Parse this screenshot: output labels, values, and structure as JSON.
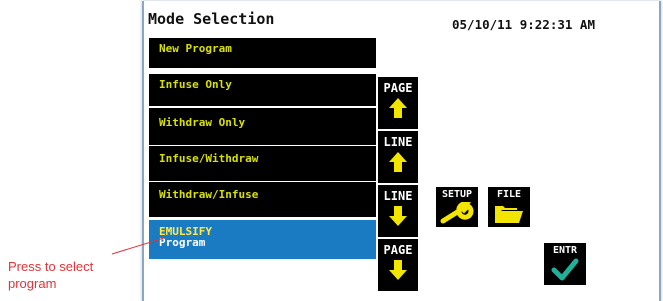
{
  "header": {
    "title": "Mode Selection",
    "datetime": "05/10/11 9:22:31 AM"
  },
  "menu": {
    "items": [
      {
        "label": "New Program"
      },
      {
        "label": "Infuse Only"
      },
      {
        "label": "Withdraw Only"
      },
      {
        "label": "Infuse/Withdraw"
      },
      {
        "label": "Withdraw/Infuse"
      }
    ],
    "selected": {
      "line1": "EMULSIFY",
      "line2": "Program"
    }
  },
  "buttons": {
    "page_up": "PAGE",
    "line_up": "LINE",
    "line_down": "LINE",
    "page_down": "PAGE",
    "setup": "SETUP",
    "file": "FILE",
    "enter": "ENTR"
  },
  "callout": {
    "text": "Press to  select program"
  },
  "colors": {
    "menu_bg": "#000000",
    "menu_text": "#d8e000",
    "selected_bg": "#1b7bc2",
    "arrow": "#f2e600",
    "check": "#1fb09a",
    "callout": "#e0343a",
    "panel_border": "#8fa7be"
  },
  "icons": {
    "page_up": "arrow-up-icon",
    "line_up": "arrow-up-icon",
    "line_down": "arrow-down-icon",
    "page_down": "arrow-down-icon",
    "setup": "wrench-icon",
    "file": "folder-icon",
    "enter": "checkmark-icon"
  }
}
